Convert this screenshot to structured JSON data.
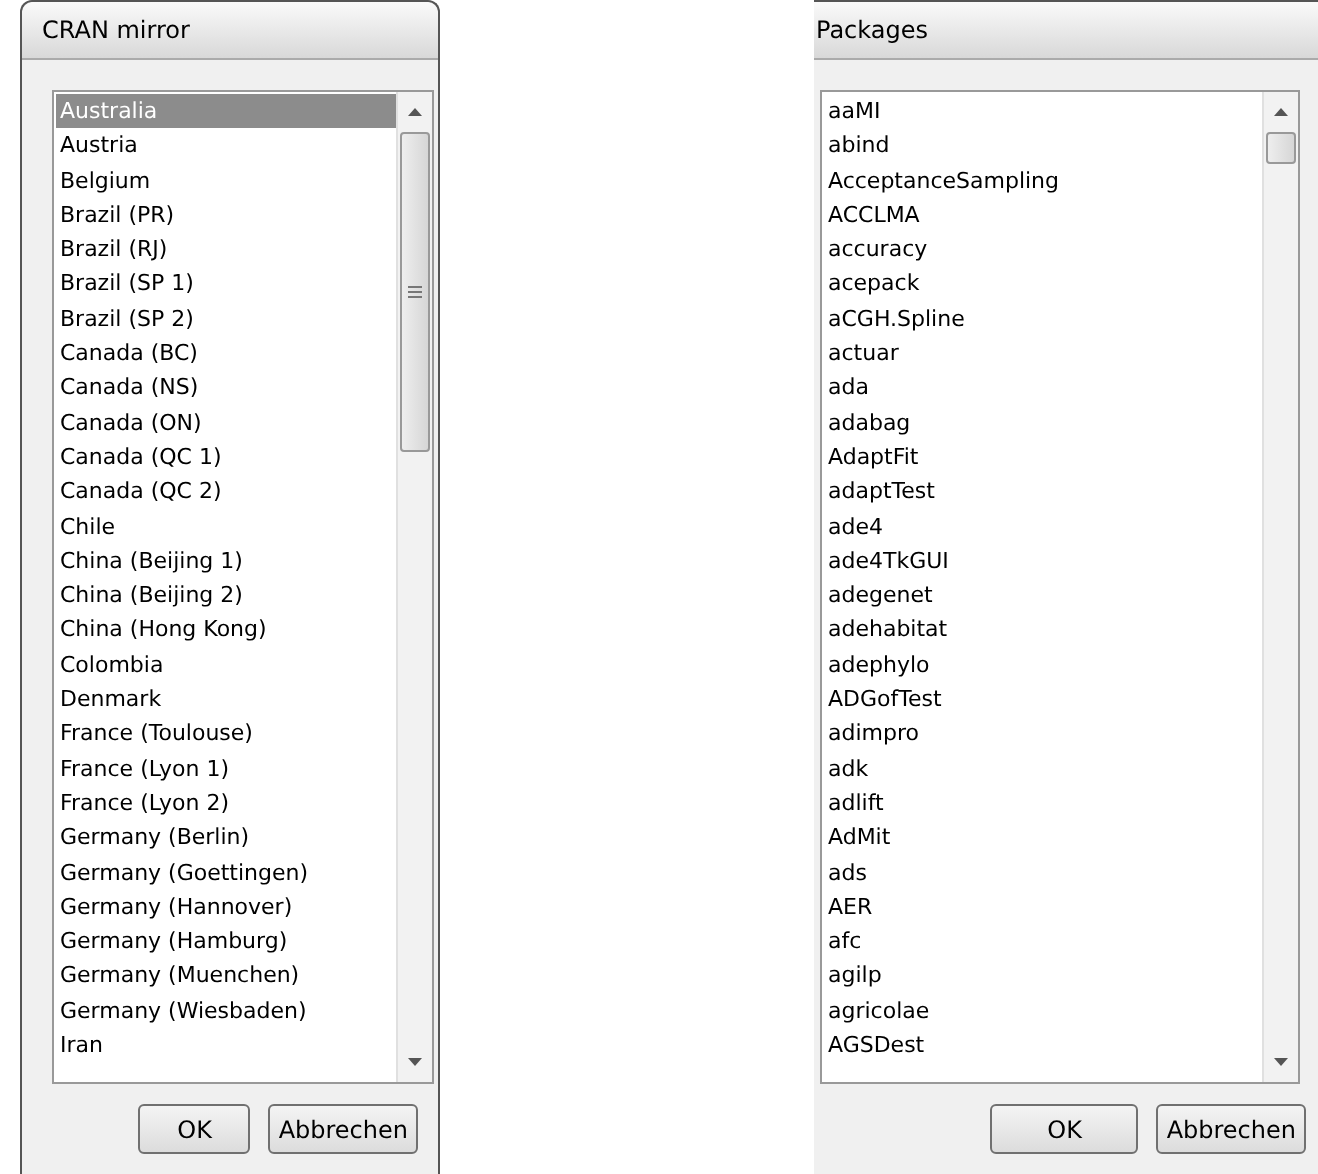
{
  "dialogs": [
    {
      "title": "CRAN mirror",
      "items": [
        {
          "label": "Australia",
          "selected": true
        },
        {
          "label": "Austria",
          "selected": false
        },
        {
          "label": "Belgium",
          "selected": false
        },
        {
          "label": "Brazil (PR)",
          "selected": false
        },
        {
          "label": "Brazil (RJ)",
          "selected": false
        },
        {
          "label": "Brazil (SP 1)",
          "selected": false
        },
        {
          "label": "Brazil (SP 2)",
          "selected": false
        },
        {
          "label": "Canada (BC)",
          "selected": false
        },
        {
          "label": "Canada (NS)",
          "selected": false
        },
        {
          "label": "Canada (ON)",
          "selected": false
        },
        {
          "label": "Canada (QC 1)",
          "selected": false
        },
        {
          "label": "Canada (QC 2)",
          "selected": false
        },
        {
          "label": "Chile",
          "selected": false
        },
        {
          "label": "China (Beijing 1)",
          "selected": false
        },
        {
          "label": "China (Beijing 2)",
          "selected": false
        },
        {
          "label": "China (Hong Kong)",
          "selected": false
        },
        {
          "label": "Colombia",
          "selected": false
        },
        {
          "label": "Denmark",
          "selected": false
        },
        {
          "label": "France (Toulouse)",
          "selected": false
        },
        {
          "label": "France (Lyon 1)",
          "selected": false
        },
        {
          "label": "France (Lyon 2)",
          "selected": false
        },
        {
          "label": "Germany (Berlin)",
          "selected": false
        },
        {
          "label": "Germany (Goettingen)",
          "selected": false
        },
        {
          "label": "Germany (Hannover)",
          "selected": false
        },
        {
          "label": "Germany (Hamburg)",
          "selected": false
        },
        {
          "label": "Germany (Muenchen)",
          "selected": false
        },
        {
          "label": "Germany (Wiesbaden)",
          "selected": false
        },
        {
          "label": "Iran",
          "selected": false
        }
      ],
      "buttons": [
        "OK",
        "Abbrechen"
      ]
    },
    {
      "title": "Packages",
      "items": [
        {
          "label": "aaMI",
          "selected": false
        },
        {
          "label": "abind",
          "selected": false
        },
        {
          "label": "AcceptanceSampling",
          "selected": false
        },
        {
          "label": "ACCLMA",
          "selected": false
        },
        {
          "label": "accuracy",
          "selected": false
        },
        {
          "label": "acepack",
          "selected": false
        },
        {
          "label": "aCGH.Spline",
          "selected": false
        },
        {
          "label": "actuar",
          "selected": false
        },
        {
          "label": "ada",
          "selected": false
        },
        {
          "label": "adabag",
          "selected": false
        },
        {
          "label": "AdaptFit",
          "selected": false
        },
        {
          "label": "adaptTest",
          "selected": false
        },
        {
          "label": "ade4",
          "selected": false
        },
        {
          "label": "ade4TkGUI",
          "selected": false
        },
        {
          "label": "adegenet",
          "selected": false
        },
        {
          "label": "adehabitat",
          "selected": false
        },
        {
          "label": "adephylo",
          "selected": false
        },
        {
          "label": "ADGofTest",
          "selected": false
        },
        {
          "label": "adimpro",
          "selected": false
        },
        {
          "label": "adk",
          "selected": false
        },
        {
          "label": "adlift",
          "selected": false
        },
        {
          "label": "AdMit",
          "selected": false
        },
        {
          "label": "ads",
          "selected": false
        },
        {
          "label": "AER",
          "selected": false
        },
        {
          "label": "afc",
          "selected": false
        },
        {
          "label": "agilp",
          "selected": false
        },
        {
          "label": "agricolae",
          "selected": false
        },
        {
          "label": "AGSDest",
          "selected": false
        }
      ],
      "buttons": [
        "OK",
        "Abbrechen"
      ]
    }
  ]
}
